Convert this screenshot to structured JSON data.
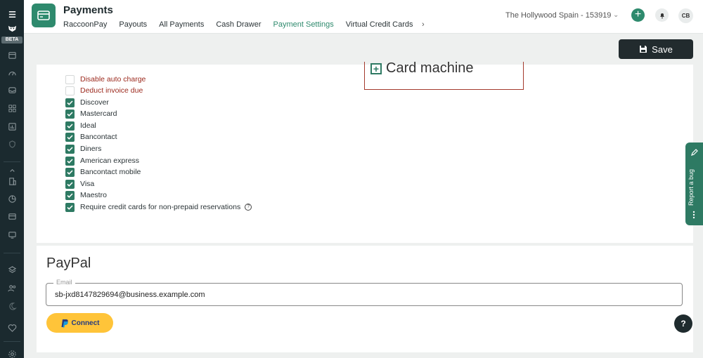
{
  "sidebar": {
    "beta_label": "BETA",
    "icons": [
      "menu-icon",
      "raccoon-logo-icon",
      "calendar-icon",
      "dashboard-icon",
      "inbox-icon",
      "apps-icon",
      "reports-icon",
      "shield-icon",
      "building-icon",
      "pie-chart-icon",
      "credit-card-icon",
      "monitor-icon",
      "layers-icon",
      "users-icon",
      "moon-icon",
      "heart-icon",
      "settings-icon"
    ]
  },
  "header": {
    "title": "Payments",
    "tabs": [
      {
        "label": "RaccoonPay",
        "active": false
      },
      {
        "label": "Payouts",
        "active": false
      },
      {
        "label": "All Payments",
        "active": false
      },
      {
        "label": "Cash Drawer",
        "active": false
      },
      {
        "label": "Payment Settings",
        "active": true
      },
      {
        "label": "Virtual Credit Cards",
        "active": false
      }
    ],
    "venue": "The Hollywood Spain - 153919",
    "avatar_initials": "CB"
  },
  "toolbar": {
    "save_label": "Save"
  },
  "card_options": {
    "items": [
      {
        "label": "Disable auto charge",
        "checked": false,
        "warning": true
      },
      {
        "label": "Deduct invoice due",
        "checked": false,
        "warning": true
      },
      {
        "label": "Discover",
        "checked": true
      },
      {
        "label": "Mastercard",
        "checked": true
      },
      {
        "label": "Ideal",
        "checked": true
      },
      {
        "label": "Bancontact",
        "checked": true
      },
      {
        "label": "Diners",
        "checked": true
      },
      {
        "label": "American express",
        "checked": true
      },
      {
        "label": "Bancontact mobile",
        "checked": true
      },
      {
        "label": "Visa",
        "checked": true
      },
      {
        "label": "Maestro",
        "checked": true
      },
      {
        "label": "Require credit cards for non-prepaid reservations",
        "checked": true,
        "help": true
      }
    ],
    "card_machine_label": "Card machine"
  },
  "paypal": {
    "title": "PayPal",
    "email_label": "Email",
    "email_value": "sb-jxd8147829694@business.example.com",
    "connect_label": "Connect"
  },
  "report_bug_label": "Report a bug",
  "help_fab_label": "?",
  "colors": {
    "accent": "#2e8a6d",
    "sidebar": "#1b2a2f",
    "warning": "#9c2a1e",
    "paypal_yellow": "#ffc439"
  }
}
